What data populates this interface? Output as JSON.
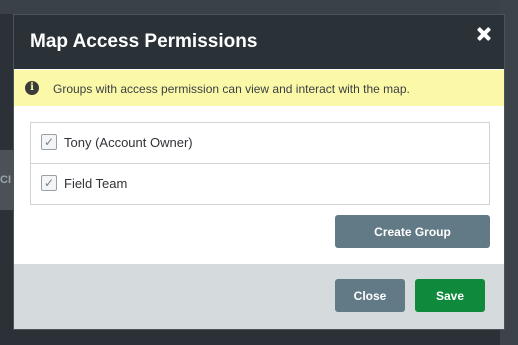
{
  "background": {
    "panel_label": "CI"
  },
  "modal": {
    "title": "Map Access Permissions",
    "close_icon": "close-icon",
    "info": {
      "icon": "info-icon",
      "text": "Groups with access permission can view and interact with the map."
    },
    "groups": [
      {
        "label": "Tony (Account Owner)",
        "checked": true
      },
      {
        "label": "Field Team",
        "checked": true
      }
    ],
    "create_group_label": "Create Group",
    "footer": {
      "close_label": "Close",
      "save_label": "Save"
    }
  },
  "colors": {
    "header_bg": "#2b3237",
    "info_bg": "#fbf9a8",
    "secondary_button": "#617a86",
    "save_button": "#0f8a3c",
    "footer_bg": "#d5dadd"
  }
}
